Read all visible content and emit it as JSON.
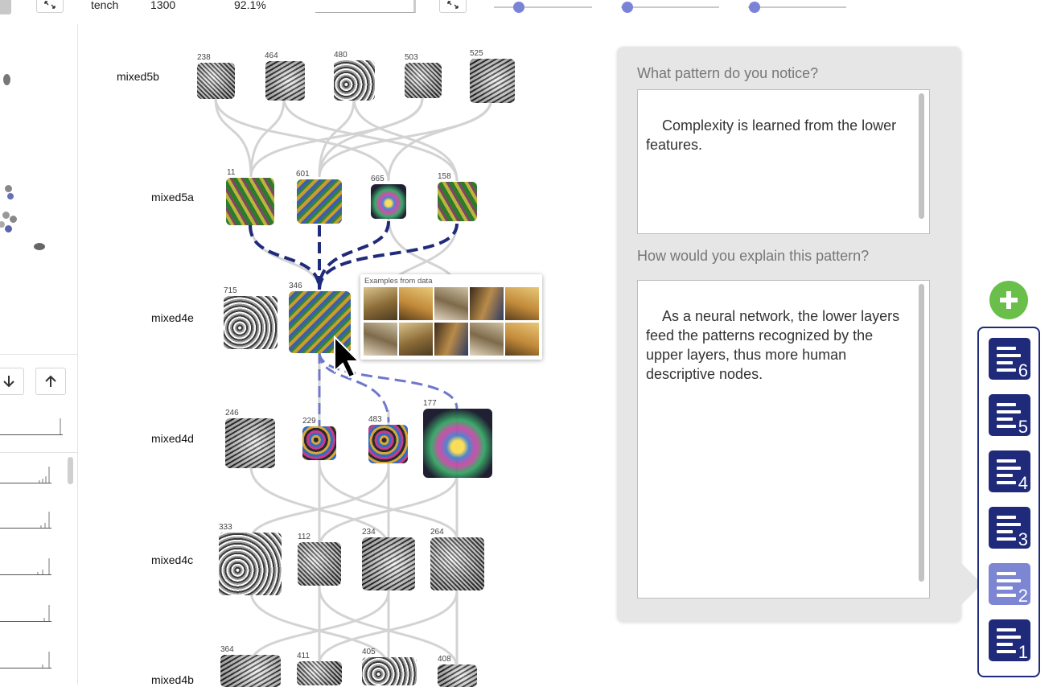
{
  "topbar": {
    "class_name": "tench",
    "count": "1300",
    "percent": "92.1%",
    "accent_color": "#7b83d6"
  },
  "graph": {
    "layers": [
      {
        "name": "mixed5b",
        "nodes": [
          "238",
          "464",
          "480",
          "503",
          "525"
        ]
      },
      {
        "name": "mixed5a",
        "nodes": [
          "11",
          "601",
          "665",
          "158"
        ]
      },
      {
        "name": "mixed4e",
        "nodes": [
          "715",
          "346"
        ]
      },
      {
        "name": "mixed4d",
        "nodes": [
          "246",
          "229",
          "483",
          "177"
        ]
      },
      {
        "name": "mixed4c",
        "nodes": [
          "333",
          "112",
          "234",
          "264"
        ]
      },
      {
        "name": "mixed4b",
        "nodes": [
          "364",
          "411",
          "405",
          "408"
        ]
      }
    ],
    "tooltip_title": "Examples from data",
    "highlight_color": "#1f2a7a"
  },
  "questions": [
    {
      "label": "What pattern do you notice?",
      "answer": "Complexity is learned from the lower features."
    },
    {
      "label": "How would you explain this pattern?",
      "answer": "As a neural network, the lower layers feed the patterns recognized by the upper layers, thus more human descriptive nodes."
    }
  ],
  "history": {
    "items": [
      "6",
      "5",
      "4",
      "3",
      "2",
      "1"
    ],
    "active": "2",
    "color": "#1f2a7a",
    "active_color": "#7d86d3",
    "add_color": "#6abf4b"
  }
}
